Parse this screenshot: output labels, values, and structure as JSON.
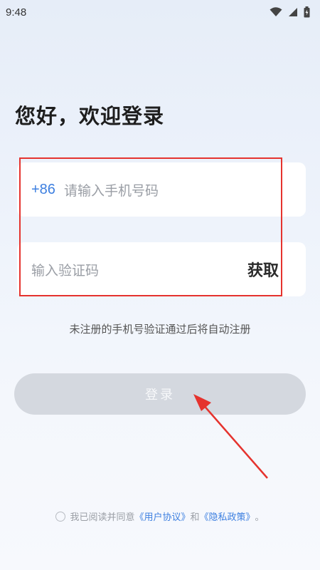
{
  "status_bar": {
    "time": "9:48",
    "icons": [
      "wifi-icon",
      "signal-icon",
      "battery-icon"
    ]
  },
  "login": {
    "title": "您好，欢迎登录",
    "phone": {
      "country_code": "+86",
      "placeholder": "请输入手机号码"
    },
    "code": {
      "placeholder": "输入验证码",
      "get_code_label": "获取"
    },
    "hint": "未注册的手机号验证通过后将自动注册",
    "login_button_label": "登录"
  },
  "agreement": {
    "prefix": "我已阅读并同意",
    "user_agreement": "《用户协议》",
    "and": "和",
    "privacy_policy": "《隐私政策》",
    "suffix": "。"
  },
  "colors": {
    "accent": "#3d7fe0",
    "annotation": "#e5332e",
    "button_disabled": "#d4d8df"
  }
}
